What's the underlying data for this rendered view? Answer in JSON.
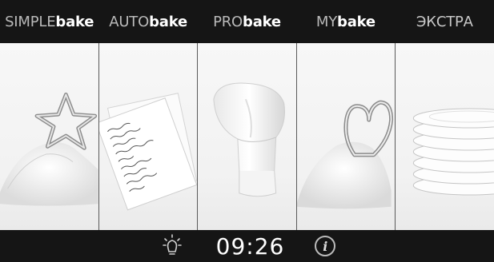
{
  "tabs": [
    {
      "pre": "SIMPLE",
      "post": "bake"
    },
    {
      "pre": "AUTO",
      "post": "bake"
    },
    {
      "pre": "PRO",
      "post": "bake"
    },
    {
      "pre": "MY",
      "post": "bake"
    },
    {
      "label": "ЭКСТРА"
    }
  ],
  "panels": [
    {
      "icon": "flour-star-cutter-icon"
    },
    {
      "icon": "recipe-papers-icon"
    },
    {
      "icon": "chef-hat-icon"
    },
    {
      "icon": "flour-heart-cutter-icon"
    },
    {
      "icon": "plate-stack-icon"
    }
  ],
  "bottom_bar": {
    "light_icon": "light-bulb-icon",
    "time": "09:26",
    "info_icon": "info-icon",
    "info_glyph": "i"
  }
}
